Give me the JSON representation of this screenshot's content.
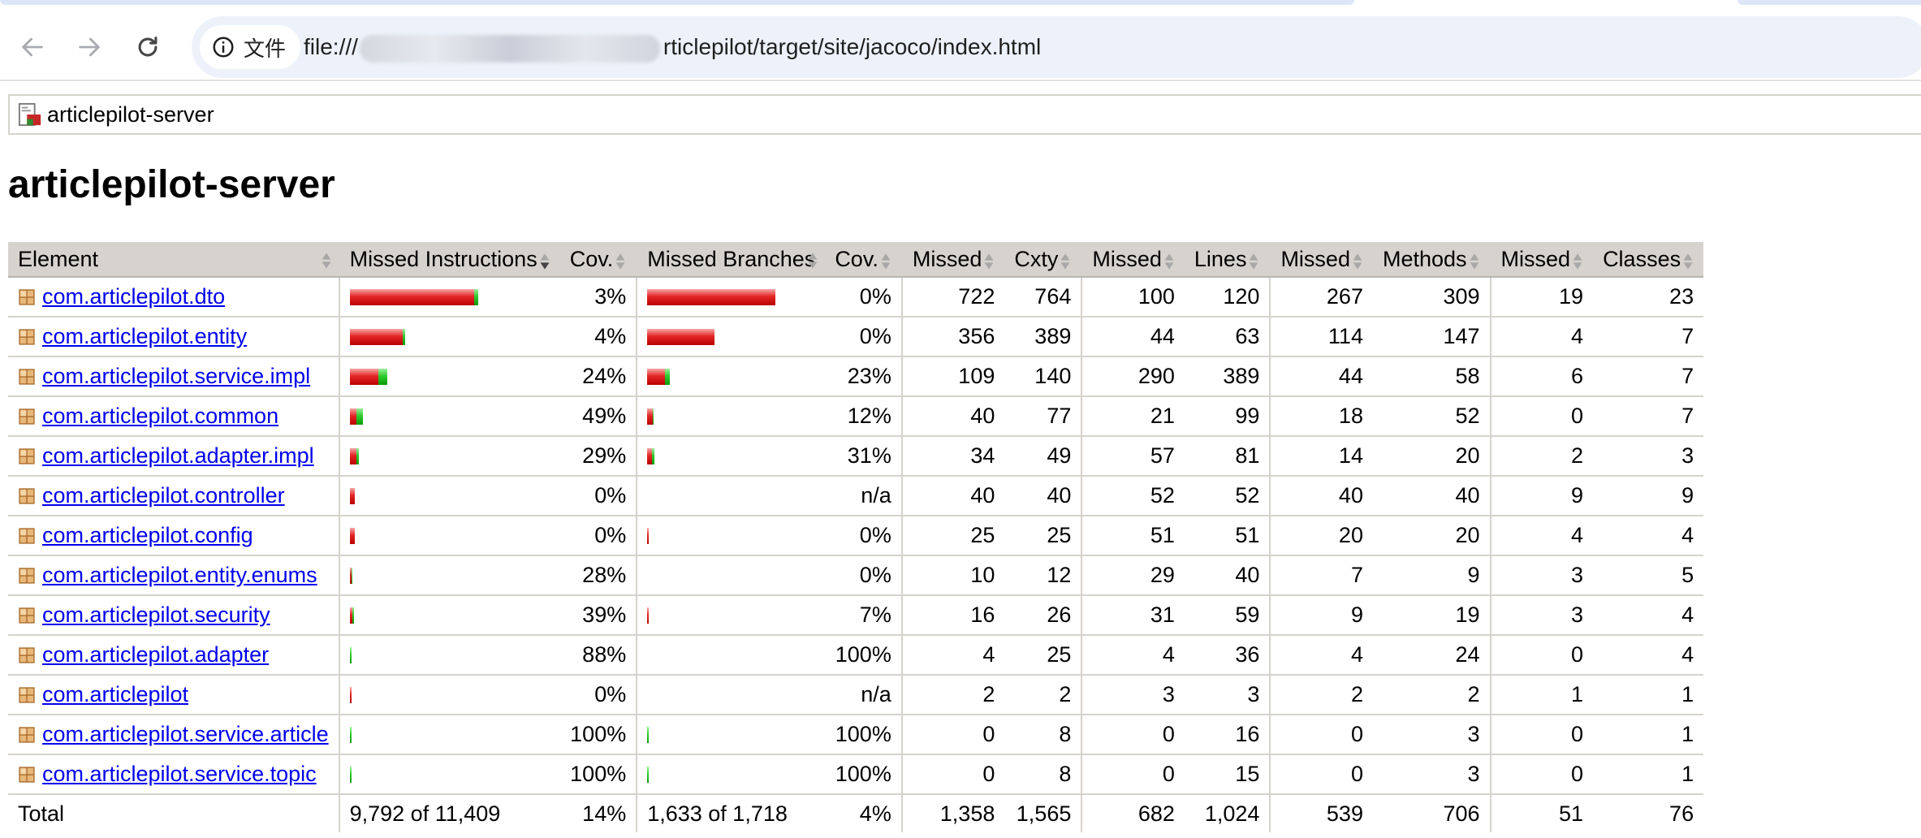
{
  "browser": {
    "chip_label": "文件",
    "url_prefix": "file:///",
    "url_suffix": "rticlepilot/target/site/jacoco/index.html",
    "icons": {
      "back": "arrow-left-icon",
      "forward": "arrow-right-icon",
      "reload": "reload-icon",
      "info": "info-circle-icon"
    }
  },
  "breadcrumb": {
    "label": "articlepilot-server",
    "icon": "report-icon"
  },
  "page": {
    "title": "articlepilot-server"
  },
  "colors": {
    "missed": "#e32626",
    "covered": "#2fcc2f",
    "header_bg": "#d6d3ce",
    "link": "#0000ee"
  },
  "coverage_table": {
    "headers": {
      "element": "Element",
      "missed_instructions": "Missed Instructions",
      "cov1": "Cov.",
      "missed_branches": "Missed Branches",
      "cov2": "Cov.",
      "missed_cxty": "Missed",
      "cxty": "Cxty",
      "missed_lines": "Missed",
      "lines": "Lines",
      "missed_methods": "Missed",
      "methods": "Methods",
      "missed_classes": "Missed",
      "classes": "Classes"
    },
    "rows": [
      {
        "name": "com.articlepilot.dto",
        "instr_cov": "3%",
        "branch_cov": "0%",
        "missed_cxty": "722",
        "cxty": "764",
        "missed_lines": "100",
        "lines": "120",
        "missed_methods": "267",
        "methods": "309",
        "missed_classes": "19",
        "classes": "23"
      },
      {
        "name": "com.articlepilot.entity",
        "instr_cov": "4%",
        "branch_cov": "0%",
        "missed_cxty": "356",
        "cxty": "389",
        "missed_lines": "44",
        "lines": "63",
        "missed_methods": "114",
        "methods": "147",
        "missed_classes": "4",
        "classes": "7"
      },
      {
        "name": "com.articlepilot.service.impl",
        "instr_cov": "24%",
        "branch_cov": "23%",
        "missed_cxty": "109",
        "cxty": "140",
        "missed_lines": "290",
        "lines": "389",
        "missed_methods": "44",
        "methods": "58",
        "missed_classes": "6",
        "classes": "7"
      },
      {
        "name": "com.articlepilot.common",
        "instr_cov": "49%",
        "branch_cov": "12%",
        "missed_cxty": "40",
        "cxty": "77",
        "missed_lines": "21",
        "lines": "99",
        "missed_methods": "18",
        "methods": "52",
        "missed_classes": "0",
        "classes": "7"
      },
      {
        "name": "com.articlepilot.adapter.impl",
        "instr_cov": "29%",
        "branch_cov": "31%",
        "missed_cxty": "34",
        "cxty": "49",
        "missed_lines": "57",
        "lines": "81",
        "missed_methods": "14",
        "methods": "20",
        "missed_classes": "2",
        "classes": "3"
      },
      {
        "name": "com.articlepilot.controller",
        "instr_cov": "0%",
        "branch_cov": "n/a",
        "missed_cxty": "40",
        "cxty": "40",
        "missed_lines": "52",
        "lines": "52",
        "missed_methods": "40",
        "methods": "40",
        "missed_classes": "9",
        "classes": "9"
      },
      {
        "name": "com.articlepilot.config",
        "instr_cov": "0%",
        "branch_cov": "0%",
        "missed_cxty": "25",
        "cxty": "25",
        "missed_lines": "51",
        "lines": "51",
        "missed_methods": "20",
        "methods": "20",
        "missed_classes": "4",
        "classes": "4"
      },
      {
        "name": "com.articlepilot.entity.enums",
        "instr_cov": "28%",
        "branch_cov": "0%",
        "missed_cxty": "10",
        "cxty": "12",
        "missed_lines": "29",
        "lines": "40",
        "missed_methods": "7",
        "methods": "9",
        "missed_classes": "3",
        "classes": "5"
      },
      {
        "name": "com.articlepilot.security",
        "instr_cov": "39%",
        "branch_cov": "7%",
        "missed_cxty": "16",
        "cxty": "26",
        "missed_lines": "31",
        "lines": "59",
        "missed_methods": "9",
        "methods": "19",
        "missed_classes": "3",
        "classes": "4"
      },
      {
        "name": "com.articlepilot.adapter",
        "instr_cov": "88%",
        "branch_cov": "100%",
        "missed_cxty": "4",
        "cxty": "25",
        "missed_lines": "4",
        "lines": "36",
        "missed_methods": "4",
        "methods": "24",
        "missed_classes": "0",
        "classes": "4"
      },
      {
        "name": "com.articlepilot",
        "instr_cov": "0%",
        "branch_cov": "n/a",
        "missed_cxty": "2",
        "cxty": "2",
        "missed_lines": "3",
        "lines": "3",
        "missed_methods": "2",
        "methods": "2",
        "missed_classes": "1",
        "classes": "1"
      },
      {
        "name": "com.articlepilot.service.article",
        "instr_cov": "100%",
        "branch_cov": "100%",
        "missed_cxty": "0",
        "cxty": "8",
        "missed_lines": "0",
        "lines": "16",
        "missed_methods": "0",
        "methods": "3",
        "missed_classes": "0",
        "classes": "1"
      },
      {
        "name": "com.articlepilot.service.topic",
        "instr_cov": "100%",
        "branch_cov": "100%",
        "missed_cxty": "0",
        "cxty": "8",
        "missed_lines": "0",
        "lines": "15",
        "missed_methods": "0",
        "methods": "3",
        "missed_classes": "0",
        "classes": "1"
      }
    ],
    "total": {
      "label": "Total",
      "missed_instructions": "9,792 of 11,409",
      "instr_cov": "14%",
      "missed_branches": "1,633 of 1,718",
      "branch_cov": "4%",
      "missed_cxty": "1,358",
      "cxty": "1,565",
      "missed_lines": "682",
      "lines": "1,024",
      "missed_methods": "539",
      "methods": "706",
      "missed_classes": "51",
      "classes": "76"
    }
  }
}
